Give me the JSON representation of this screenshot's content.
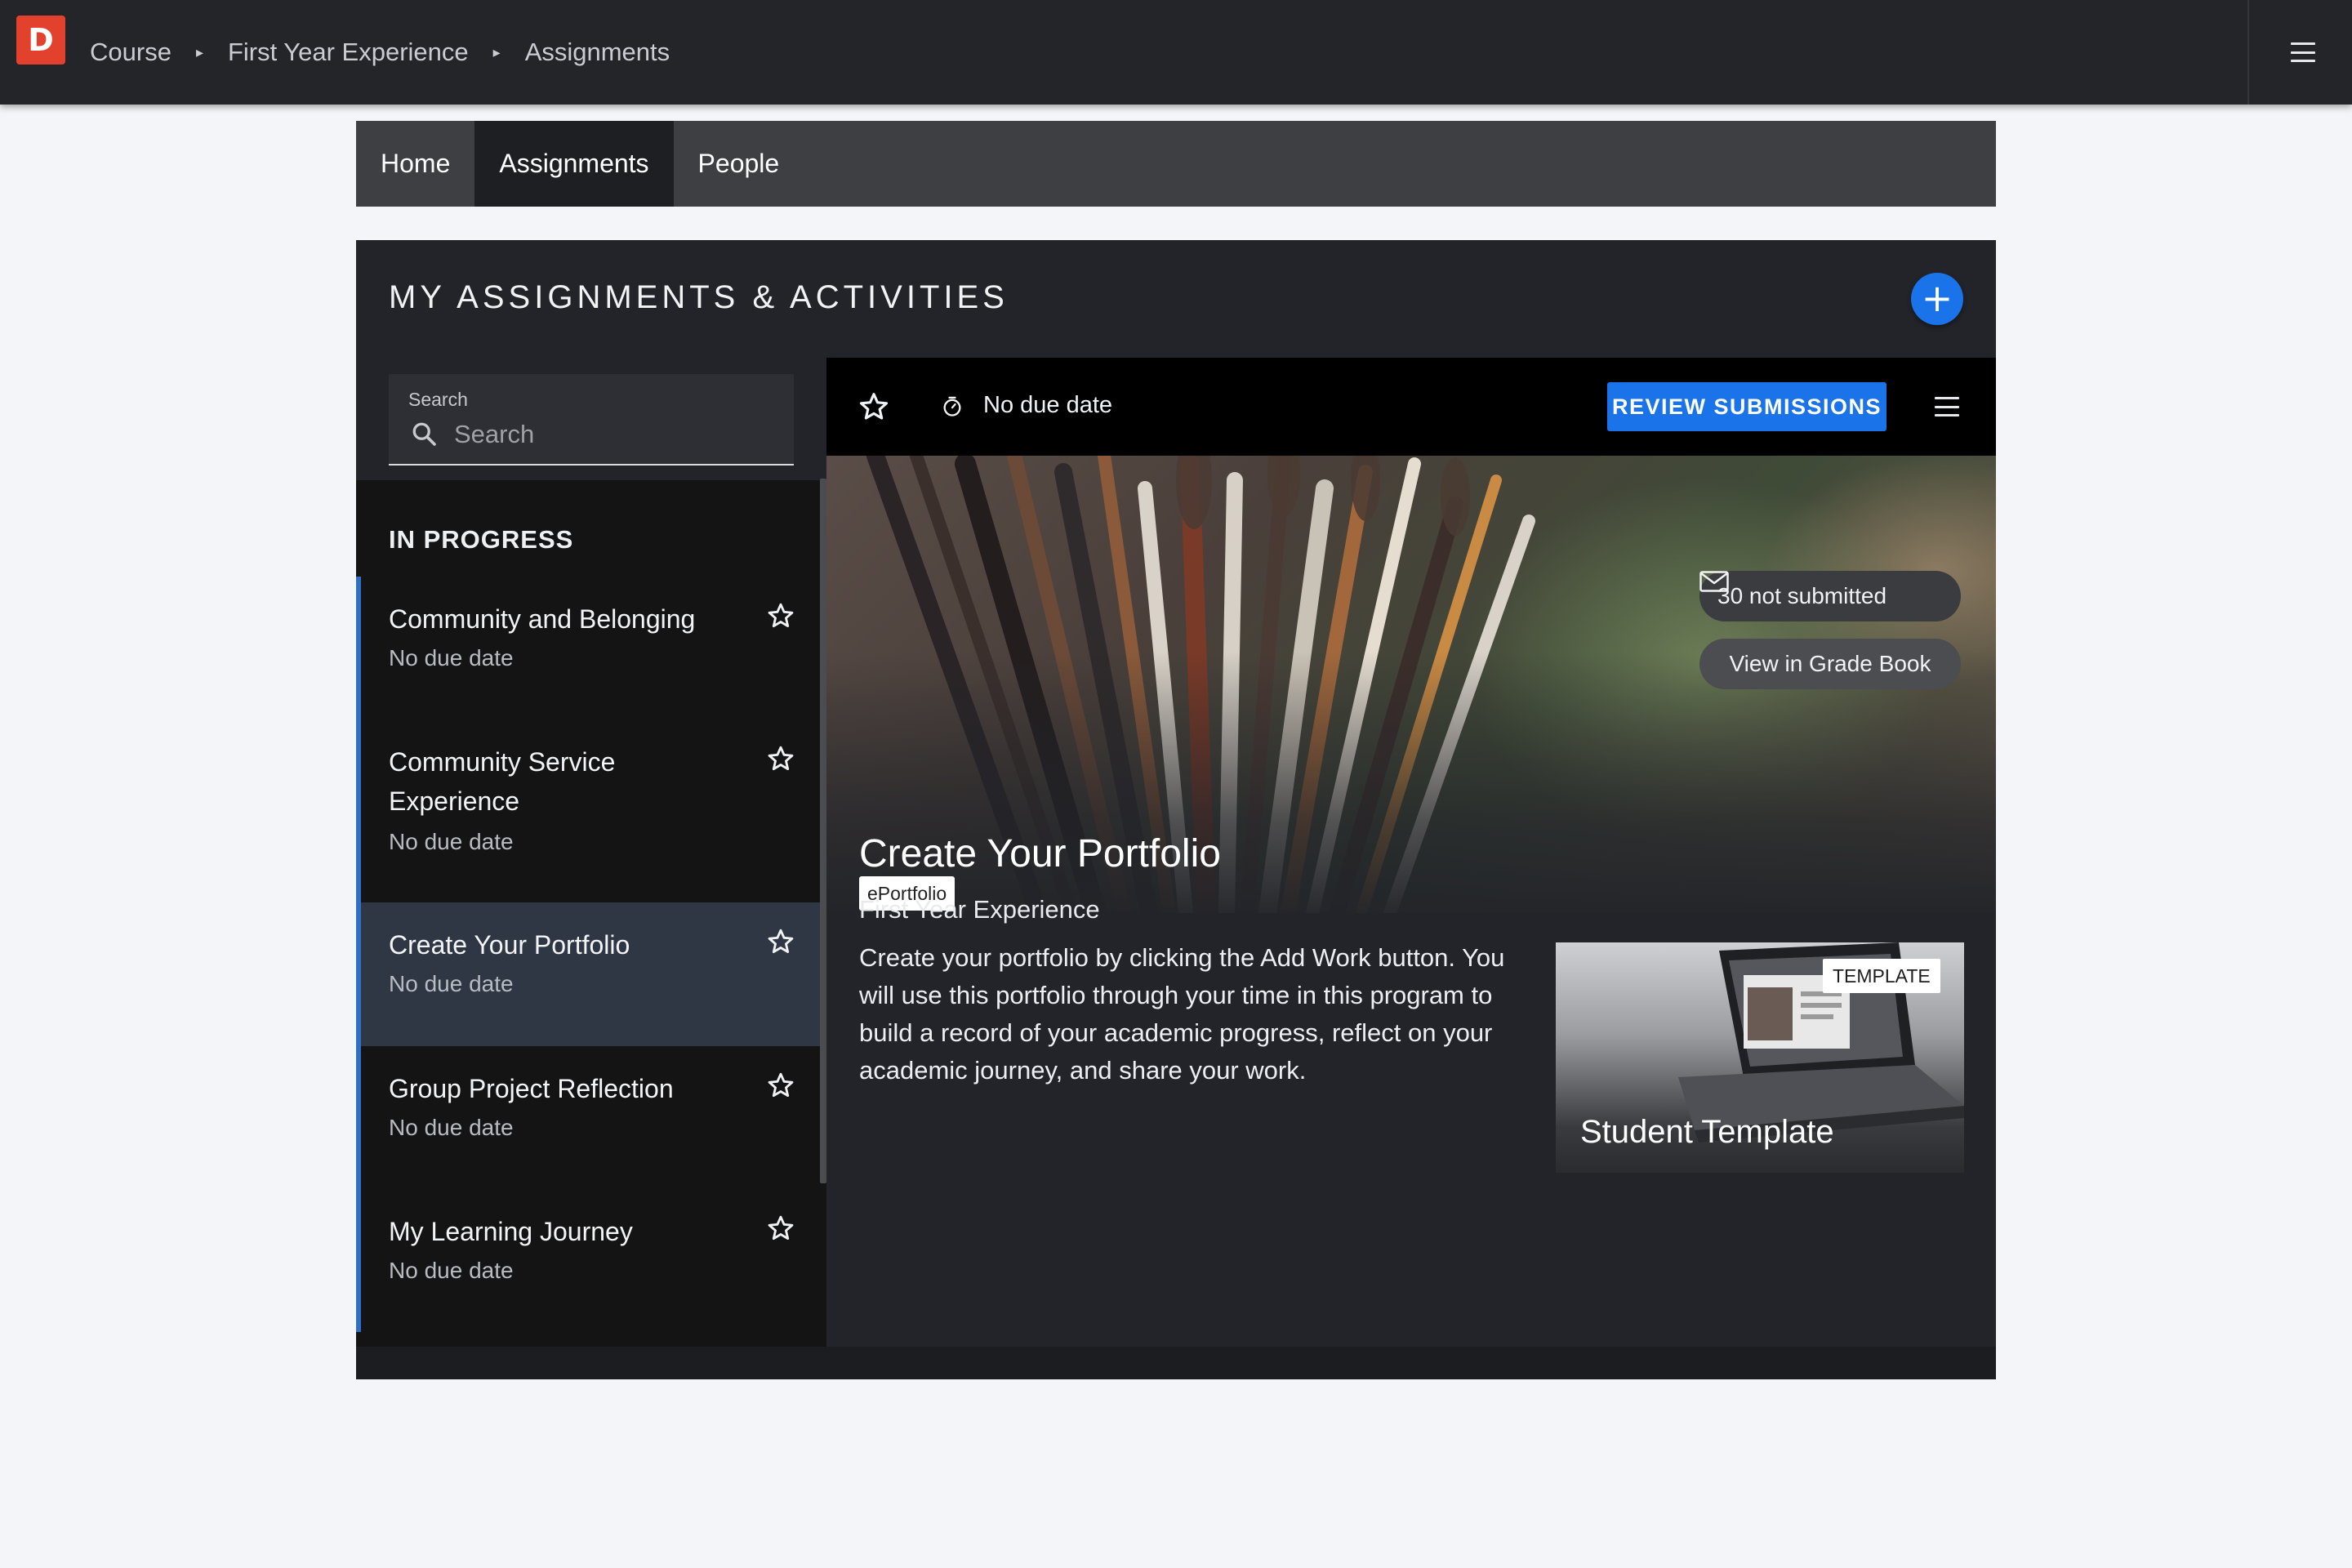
{
  "app": {
    "logo_letter": "D"
  },
  "breadcrumbs": [
    "Course",
    "First Year Experience",
    "Assignments"
  ],
  "course_nav": {
    "tabs": [
      {
        "label": "Home",
        "active": false
      },
      {
        "label": "Assignments",
        "active": true
      },
      {
        "label": "People",
        "active": false
      }
    ]
  },
  "panel": {
    "title": "MY ASSIGNMENTS & ACTIVITIES",
    "add_button": "+"
  },
  "search": {
    "label": "Search",
    "placeholder": "Search"
  },
  "list": {
    "section": "IN PROGRESS",
    "items": [
      {
        "title": "Community and Belonging",
        "due": "No due date",
        "selected": false
      },
      {
        "title": "Community Service Experience",
        "due": "No due date",
        "selected": false
      },
      {
        "title": "Create Your Portfolio",
        "due": "No due date",
        "selected": true
      },
      {
        "title": "Group Project Reflection",
        "due": "No due date",
        "selected": false
      },
      {
        "title": "My Learning Journey",
        "due": "No due date",
        "selected": false
      }
    ]
  },
  "detail": {
    "due": "No due date",
    "review_button": "REVIEW SUBMISSIONS",
    "not_submitted": "30 not submitted",
    "grade_book_button": "View in Grade Book",
    "tag": "ePortfolio",
    "title": "Create Your Portfolio",
    "course": "First Year Experience",
    "description": "Create your portfolio by clicking the Add Work button. You will use this portfolio through your time in this program to build a record of your academic progress, reflect on your academic journey, and share your work.",
    "template": {
      "badge": "TEMPLATE",
      "name": "Student Template"
    }
  },
  "colors": {
    "brand": "#e2422d",
    "accent": "#1a73e8",
    "selected_row": "#2f3744",
    "list_indicator": "#2f6fc4"
  },
  "icons": {
    "menu": "hamburger-icon",
    "star": "star-outline-icon",
    "timer": "timer-icon",
    "search": "search-icon",
    "mail": "mail-icon",
    "breadcrumb_sep": "caret-right-icon"
  }
}
